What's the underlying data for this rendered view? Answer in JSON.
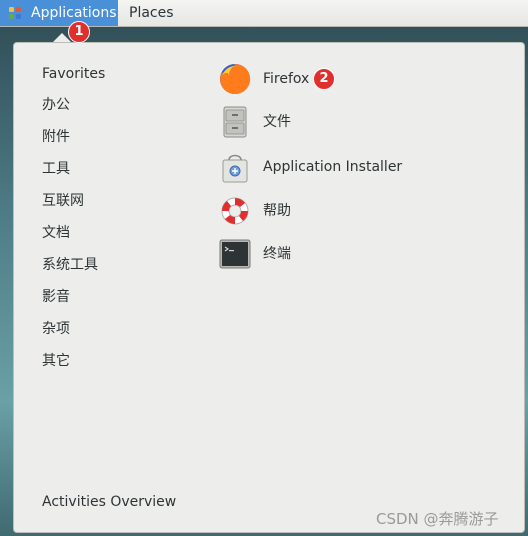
{
  "topbar": {
    "applications_label": "Applications",
    "places_label": "Places"
  },
  "badges": {
    "first": "1",
    "second": "2"
  },
  "categories": [
    "Favorites",
    "办公",
    "附件",
    "工具",
    "互联网",
    "文档",
    "系统工具",
    "影音",
    "杂项",
    "其它"
  ],
  "apps": [
    {
      "label": "Firefox",
      "icon": "firefox-icon"
    },
    {
      "label": "文件",
      "icon": "file-cabinet-icon"
    },
    {
      "label": "Application Installer",
      "icon": "software-bag-icon"
    },
    {
      "label": "帮助",
      "icon": "lifebuoy-icon"
    },
    {
      "label": "终端",
      "icon": "terminal-icon"
    }
  ],
  "footer": {
    "activities_label": "Activities Overview"
  },
  "watermark": "CSDN @奔腾游子",
  "colors": {
    "accent": "#4a90d9",
    "badge": "#e0302e",
    "menu_bg": "#ededeb"
  }
}
